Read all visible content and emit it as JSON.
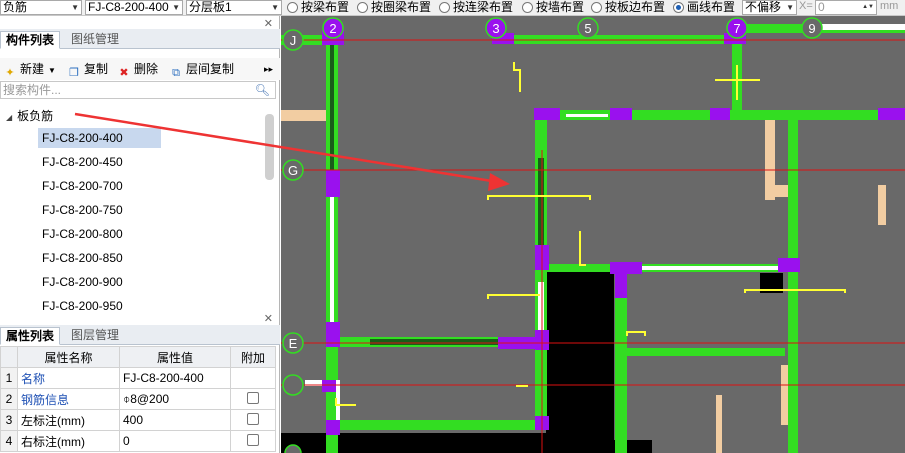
{
  "toolbar": {
    "type_combo": "负筋",
    "spec_combo": "FJ-C8-200-400",
    "layer_combo": "分层板1",
    "radios": [
      {
        "label": "按梁布置",
        "checked": false
      },
      {
        "label": "按圈梁布置",
        "checked": false
      },
      {
        "label": "按连梁布置",
        "checked": false
      },
      {
        "label": "按墙布置",
        "checked": false
      },
      {
        "label": "按板边布置",
        "checked": false
      },
      {
        "label": "画线布置",
        "checked": true
      }
    ],
    "offset_combo": "不偏移",
    "x_label": "X=",
    "x_value": "0",
    "unit": "mm"
  },
  "component_panel": {
    "tabs": [
      "构件列表",
      "图纸管理"
    ],
    "active_tab": "构件列表",
    "buttons": {
      "new": "新建",
      "copy": "复制",
      "delete": "删除",
      "floor_copy": "层间复制"
    },
    "search_placeholder": "搜索构件...",
    "tree_root": "板负筋",
    "items": [
      "FJ-C8-200-400",
      "FJ-C8-200-450",
      "FJ-C8-200-700",
      "FJ-C8-200-750",
      "FJ-C8-200-800",
      "FJ-C8-200-850",
      "FJ-C8-200-900",
      "FJ-C8-200-950"
    ],
    "selected_item": "FJ-C8-200-400"
  },
  "property_panel": {
    "tabs": [
      "属性列表",
      "图层管理"
    ],
    "active_tab": "属性列表",
    "columns": [
      "属性名称",
      "属性值",
      "附加"
    ],
    "rows": [
      {
        "num": "1",
        "name": "名称",
        "value": "FJ-C8-200-400",
        "has_check": false
      },
      {
        "num": "2",
        "name": "钢筋信息",
        "value": "⌽8@200",
        "has_check": true
      },
      {
        "num": "3",
        "name": "左标注(mm)",
        "value": "400",
        "has_check": true
      },
      {
        "num": "4",
        "name": "右标注(mm)",
        "value": "0",
        "has_check": true
      }
    ]
  },
  "canvas": {
    "axis_labels_top": [
      "J",
      "2",
      "3",
      "5",
      "7",
      "9"
    ],
    "axis_labels_left": [
      "G",
      "E"
    ],
    "colors": {
      "background": "#696969",
      "beam_green": "#33dd22",
      "column_purple": "#9a11ee",
      "slab_rebar_yellow": "#ffff33",
      "grid_red": "#dd1111",
      "dark_beam": "#1a5c1a",
      "opening_black": "#000000",
      "tan_wall": "#f2cda2",
      "annotation_arrow": "#ee3333"
    }
  }
}
